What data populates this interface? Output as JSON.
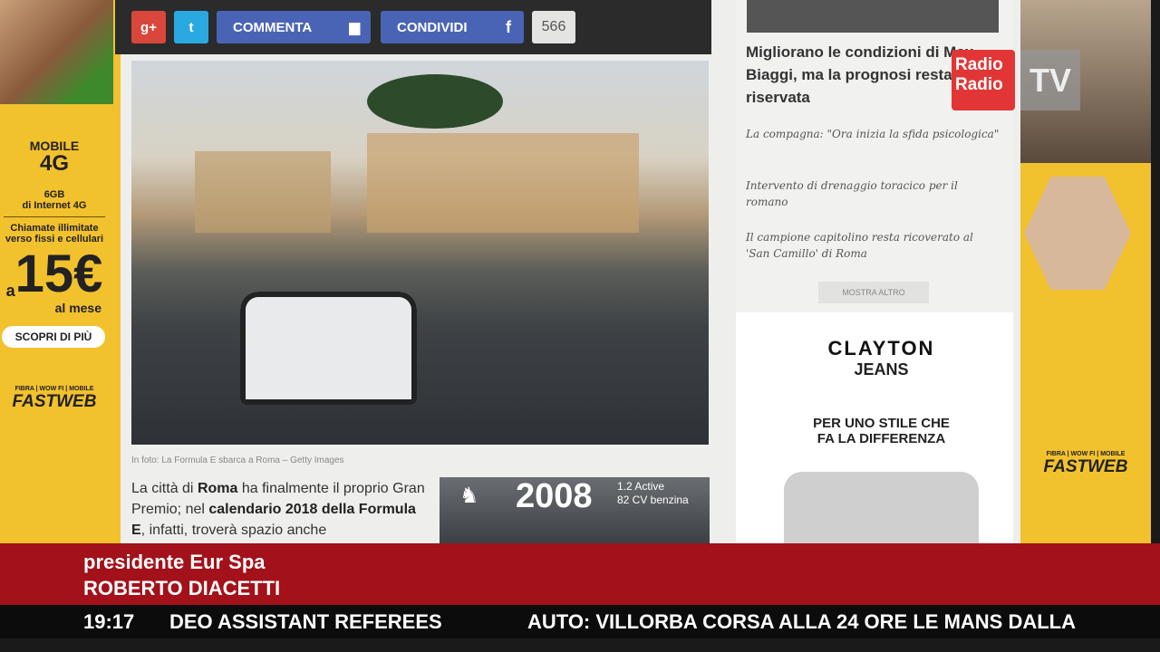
{
  "share_bar": {
    "gplus": "g+",
    "twitter": "t",
    "comment_label": "COMMENTA",
    "share_label": "CONDIVIDI",
    "facebook": "f",
    "share_count": "566"
  },
  "article": {
    "caption": "In foto: La Formula E sbarca a Roma – Getty Images",
    "body": [
      "La città di ",
      "Roma",
      " ha finalmente il proprio Gran Premio; nel ",
      "calendario 2018 della Formula E",
      ", infatti, troverà spazio anche"
    ]
  },
  "peugeot_ad": {
    "model": "2008",
    "spec1": "1.2 Active",
    "spec2": "82 CV benzina"
  },
  "sidebar": {
    "headline": "Migliorano le condizioni di Max Biaggi, ma la prognosi resta riservata",
    "related": [
      "La compagna: \"Ora inizia la sfida psicologica\"",
      "Intervento di drenaggio toracico per il romano",
      "Il campione capitolino resta ricoverato al 'San Camillo' di Roma"
    ],
    "more_label": "MOSTRA ALTRO"
  },
  "clayton_ad": {
    "brand": "CLAYTON",
    "sub": "JEANS",
    "tagline1": "PER UNO STILE CHE",
    "tagline2": "FA LA DIFFERENZA"
  },
  "fastweb_ad": {
    "l1": "MOBILE",
    "l2": "4G",
    "l3": "6GB",
    "l4": "di Internet 4G",
    "l5": "Chiamate illimitate",
    "l6": "verso fissi e cellulari",
    "a": "a",
    "price": "15€",
    "per": "al mese",
    "cta": "SCOPRI DI PIÙ",
    "tagline": "FIBRA | WOW FI | MOBILE",
    "logo": "FASTWEB"
  },
  "broadcast": {
    "logo1": "Radio",
    "logo2": "Radio",
    "tv": "TV",
    "role": "presidente Eur Spa",
    "name": "ROBERTO DIACETTI",
    "time": "19:17",
    "ticker1": "DEO ASSISTANT REFEREES",
    "ticker2": "AUTO: VILLORBA CORSA ALLA 24 ORE LE MANS DALLA"
  }
}
